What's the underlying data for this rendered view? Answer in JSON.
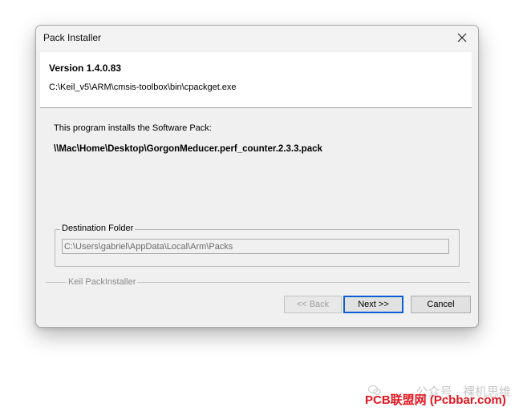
{
  "window": {
    "title": "Pack Installer"
  },
  "header": {
    "version": "Version 1.4.0.83",
    "exe_path": "C:\\Keil_v5\\ARM\\cmsis-toolbox\\bin\\cpackget.exe"
  },
  "body": {
    "intro": "This program installs the Software Pack:",
    "pack_path": "\\\\Mac\\Home\\Desktop\\GorgonMeducer.perf_counter.2.3.3.pack"
  },
  "destination": {
    "legend": "Destination Folder",
    "value": "C:\\Users\\gabriel\\AppData\\Local\\Arm\\Packs"
  },
  "footer": {
    "label": "Keil PackInstaller"
  },
  "buttons": {
    "back": "<< Back",
    "next": "Next >>",
    "cancel": "Cancel"
  },
  "overlay": {
    "watermark": "公众号 · 裸机思维",
    "brand": "PCB联盟网 (Pcbbar.com)"
  },
  "colors": {
    "focus_border": "#0a5fd6",
    "brand_red": "#e8141e"
  },
  "icons": {
    "close": "close-icon",
    "watermark": "wechat-icon"
  }
}
